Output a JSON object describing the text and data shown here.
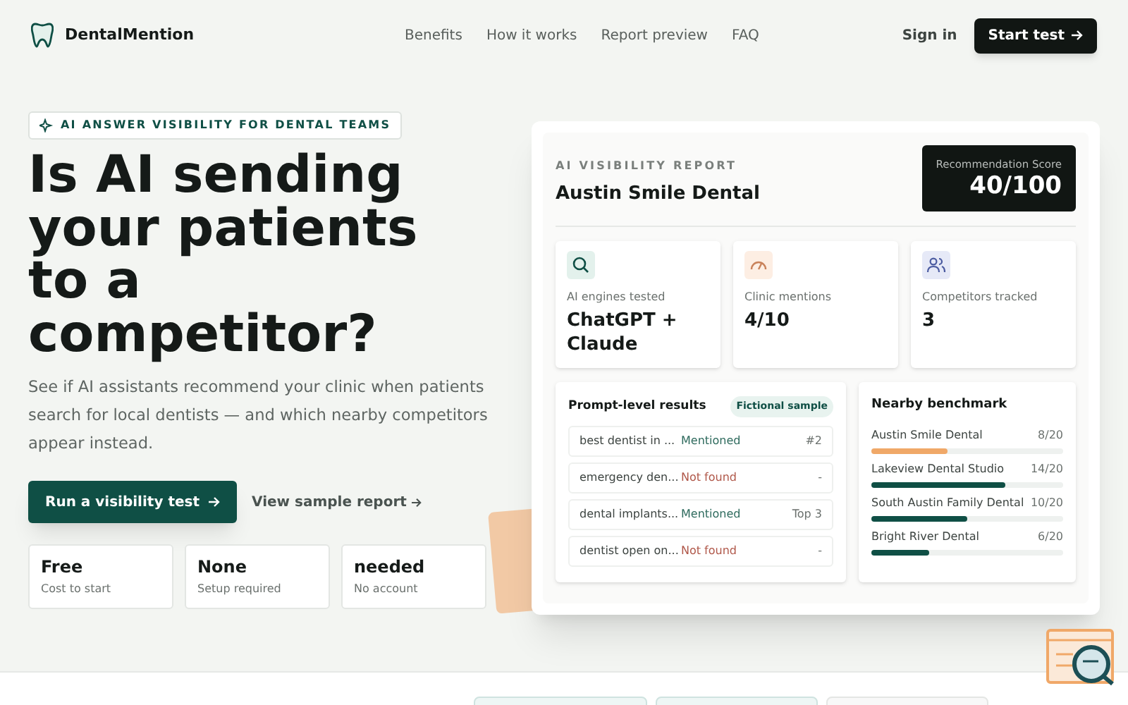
{
  "header": {
    "logo": "DentalMention",
    "nav": [
      "Benefits",
      "How it works",
      "Report preview",
      "FAQ"
    ],
    "sign_in": "Sign in",
    "cta": "Start test"
  },
  "hero": {
    "badge": "AI ANSWER VISIBILITY FOR DENTAL TEAMS",
    "heading": "Is AI sending your patients to a competitor?",
    "subtitle": "See if AI assistants recommend your clinic when patients search for local dentists — and which nearby competitors appear instead.",
    "primary_button": "Run a visibility test",
    "secondary_link": "View sample report",
    "stats": [
      {
        "value": "Free",
        "label": "Cost to start"
      },
      {
        "value": "None",
        "label": "Setup required"
      },
      {
        "value": "needed",
        "label": "No account"
      }
    ]
  },
  "report": {
    "eyebrow": "AI VISIBILITY REPORT",
    "clinic": "Austin Smile Dental",
    "score_label": "Recommendation Score",
    "score": "40/100",
    "metrics": [
      {
        "kind": "search",
        "label": "AI engines tested",
        "value": "ChatGPT + Claude"
      },
      {
        "kind": "gauge",
        "label": "Clinic mentions",
        "value": "4/10"
      },
      {
        "kind": "people",
        "label": "Competitors tracked",
        "value": "3"
      }
    ],
    "prompts": {
      "title": "Prompt-level results",
      "badge": "Fictional sample",
      "rows": [
        {
          "prompt": "best dentist in ...",
          "status": "Mentioned",
          "found": true,
          "rank": "#2"
        },
        {
          "prompt": "emergency den...",
          "status": "Not found",
          "found": false,
          "rank": "-"
        },
        {
          "prompt": "dental implants...",
          "status": "Mentioned",
          "found": true,
          "rank": "Top 3"
        },
        {
          "prompt": "dentist open on...",
          "status": "Not found",
          "found": false,
          "rank": "-"
        }
      ]
    },
    "benchmark": {
      "title": "Nearby benchmark",
      "rows": [
        {
          "name": "Austin Smile Dental",
          "score": "8/20",
          "level": 0.4,
          "color": "#f0a868"
        },
        {
          "name": "Lakeview Dental Studio",
          "score": "14/20",
          "level": 0.7,
          "color": "#0f4f45"
        },
        {
          "name": "South Austin Family Dental",
          "score": "10/20",
          "level": 0.5,
          "color": "#0f4f45"
        },
        {
          "name": "Bright River Dental",
          "score": "6/20",
          "level": 0.3,
          "color": "#0f4f45"
        }
      ]
    }
  }
}
